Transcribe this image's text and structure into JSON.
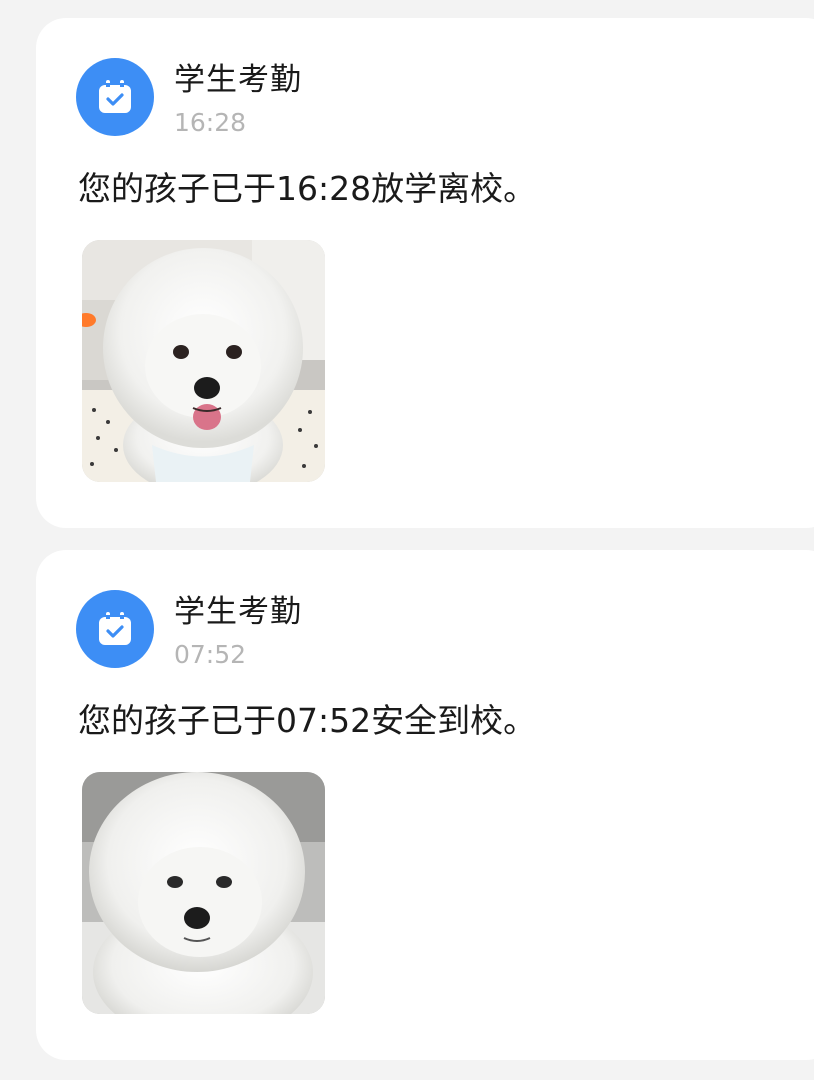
{
  "notifications": [
    {
      "app_name": "学生考勤",
      "time": "16:28",
      "message": "您的孩子已于16:28放学离校。",
      "icon": "calendar-check-icon",
      "photo": "white-bichon-dog-photo"
    },
    {
      "app_name": "学生考勤",
      "time": "07:52",
      "message": "您的孩子已于07:52安全到校。",
      "icon": "calendar-check-icon",
      "photo": "white-bichon-dog-photo"
    }
  ],
  "colors": {
    "page_background": "#f3f3f3",
    "card_background": "#ffffff",
    "icon_blue": "#3d8ef5",
    "time_gray": "#b5b5b5",
    "text_dark": "#1a1a1a"
  }
}
